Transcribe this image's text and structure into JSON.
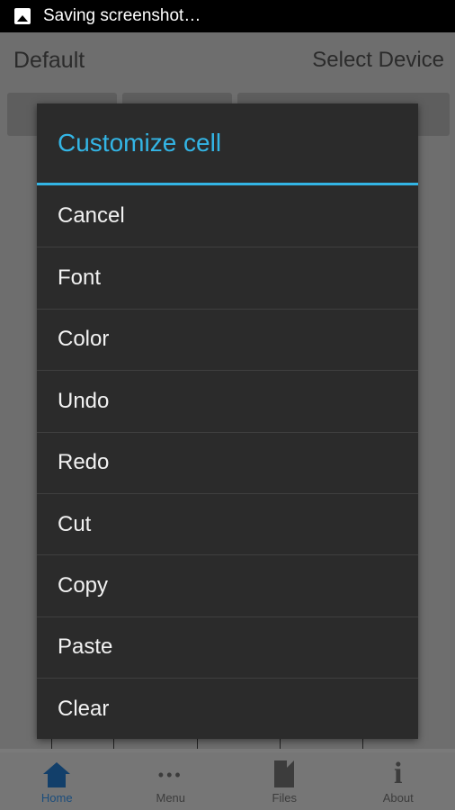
{
  "status": {
    "text": "Saving screenshot…",
    "icon": "screenshot-icon"
  },
  "app": {
    "left_label": "Default",
    "right_label": "Select Device"
  },
  "dialog": {
    "title": "Customize cell",
    "accent_color": "#33b5e5",
    "items": [
      "Cancel",
      "Font",
      "Color",
      "Undo",
      "Redo",
      "Cut",
      "Copy",
      "Paste",
      "Clear"
    ]
  },
  "nav": {
    "items": [
      {
        "label": "Home",
        "icon": "home-icon"
      },
      {
        "label": "Menu",
        "icon": "more-dots-icon"
      },
      {
        "label": "Files",
        "icon": "file-icon"
      },
      {
        "label": "About",
        "icon": "info-icon"
      }
    ]
  }
}
